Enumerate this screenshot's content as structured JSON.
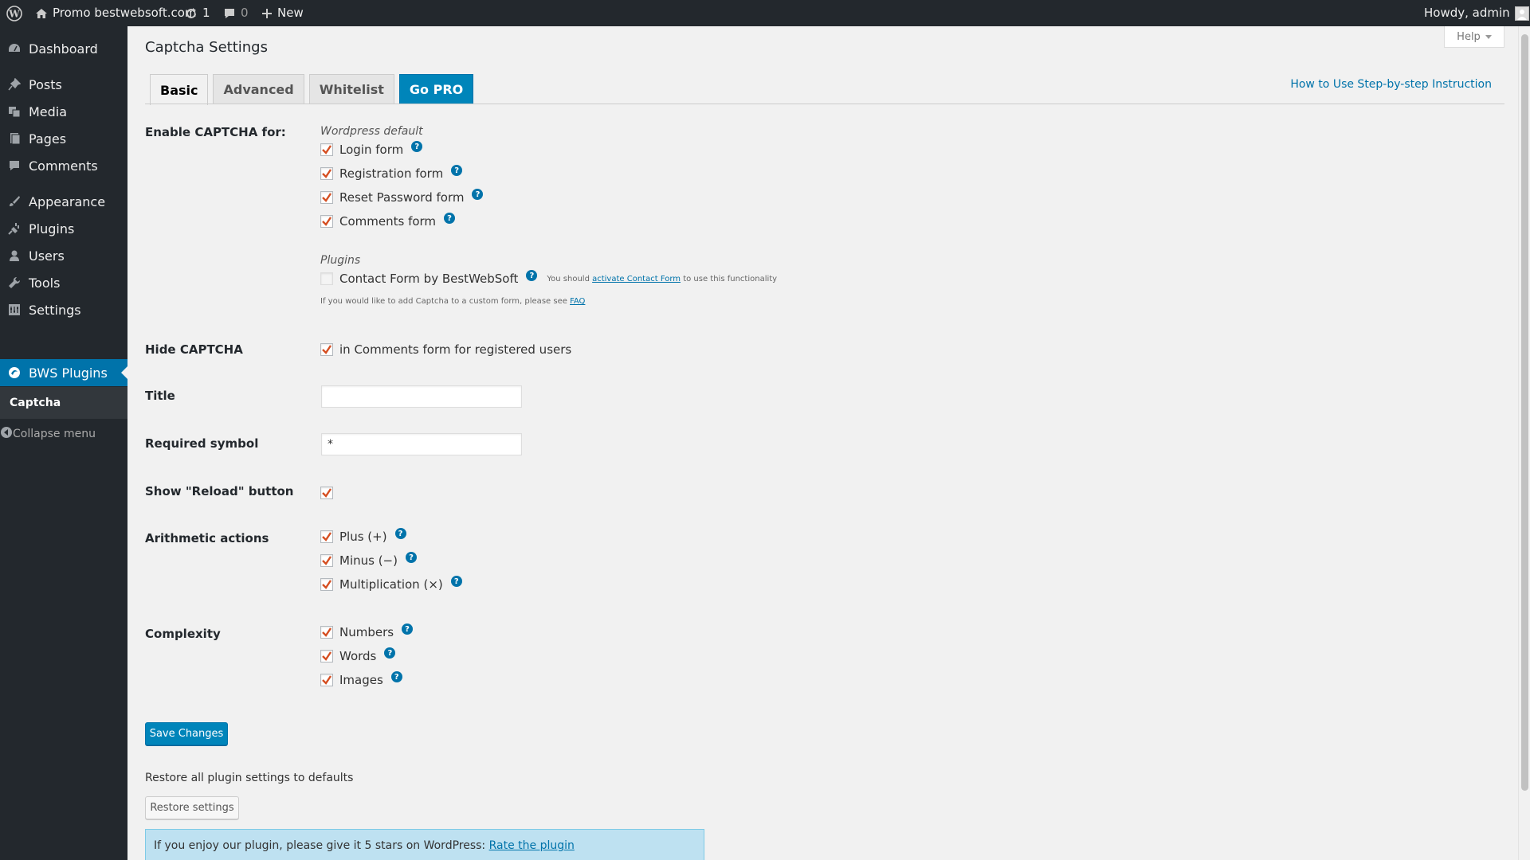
{
  "adminbar": {
    "site_name": "Promo bestwebsoft.com",
    "updates_count": "1",
    "comments_count": "0",
    "new_label": "New",
    "howdy": "Howdy, admin"
  },
  "sidebar": {
    "items": [
      {
        "label": "Dashboard",
        "icon": "dashboard-icon"
      },
      {
        "label": "Posts",
        "icon": "pin-icon"
      },
      {
        "label": "Media",
        "icon": "media-icon"
      },
      {
        "label": "Pages",
        "icon": "pages-icon"
      },
      {
        "label": "Comments",
        "icon": "comment-icon"
      },
      {
        "label": "Appearance",
        "icon": "brush-icon"
      },
      {
        "label": "Plugins",
        "icon": "plug-icon"
      },
      {
        "label": "Users",
        "icon": "user-icon"
      },
      {
        "label": "Tools",
        "icon": "wrench-icon"
      },
      {
        "label": "Settings",
        "icon": "settings-icon"
      },
      {
        "label": "BWS Plugins",
        "icon": "bws-icon"
      }
    ],
    "submenu_item": "Captcha",
    "collapse_label": "Collapse menu"
  },
  "header": {
    "help_label": "Help",
    "page_title": "Captcha Settings",
    "howto_link": "How to Use Step-by-step Instruction"
  },
  "tabs": [
    "Basic",
    "Advanced",
    "Whitelist",
    "Go PRO"
  ],
  "settings": {
    "enable_label": "Enable CAPTCHA for:",
    "wp_default_title": "Wordpress default",
    "wp_forms": [
      "Login form",
      "Registration form",
      "Reset Password form",
      "Comments form"
    ],
    "plugins_title": "Plugins",
    "contact_form_label": "Contact Form by BestWebSoft",
    "contact_note_prefix": "You should",
    "contact_note_link": "activate Contact Form",
    "contact_note_suffix": "to use this functionality",
    "faq_note_prefix": "If you would like to add Captcha to a custom form, please see",
    "faq_link": "FAQ",
    "hide_label": "Hide CAPTCHA",
    "hide_option": "in Comments form for registered users",
    "title_label": "Title",
    "title_value": "",
    "required_label": "Required symbol",
    "required_value": "*",
    "reload_label": "Show \"Reload\" button",
    "arith_label": "Arithmetic actions",
    "arith_options": [
      "Plus (+)",
      "Minus (−)",
      "Multiplication (×)"
    ],
    "complexity_label": "Complexity",
    "complexity_options": [
      "Numbers",
      "Words",
      "Images"
    ]
  },
  "footer": {
    "save_label": "Save Changes",
    "restore_text": "Restore all plugin settings to defaults",
    "restore_label": "Restore settings",
    "rate_text": "If you enjoy our plugin, please give it 5 stars on WordPress:",
    "rate_link": "Rate the plugin"
  },
  "colors": {
    "accent": "#0073aa",
    "sidebar_bg": "#23282d",
    "checkmark": "#d54e21"
  }
}
